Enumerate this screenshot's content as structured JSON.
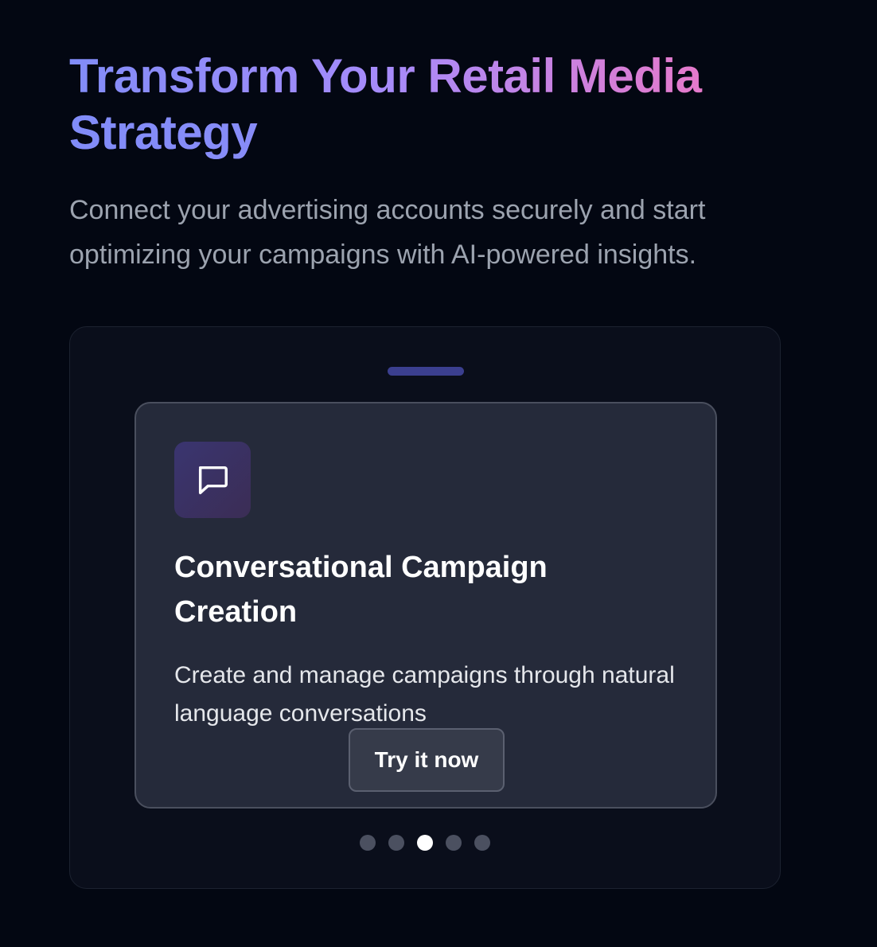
{
  "hero": {
    "title_line1": "Transform Your Retail Media",
    "title_line2": "Strategy",
    "subtitle": "Connect your advertising accounts securely and start optimizing your campaigns with AI-powered insights."
  },
  "carousel": {
    "current_slide": {
      "icon": "message-square-icon",
      "title": "Conversational Campaign Creation",
      "description": "Create and manage campaigns through natural language conversations",
      "cta_label": "Try it now"
    },
    "total_slides": 5,
    "active_index": 2
  },
  "colors": {
    "background": "#030712",
    "title_gradient_start": "#818cf8",
    "title_gradient_end": "#e879c9",
    "active_dot": "#ffffff",
    "inactive_dot": "#4b5060"
  }
}
